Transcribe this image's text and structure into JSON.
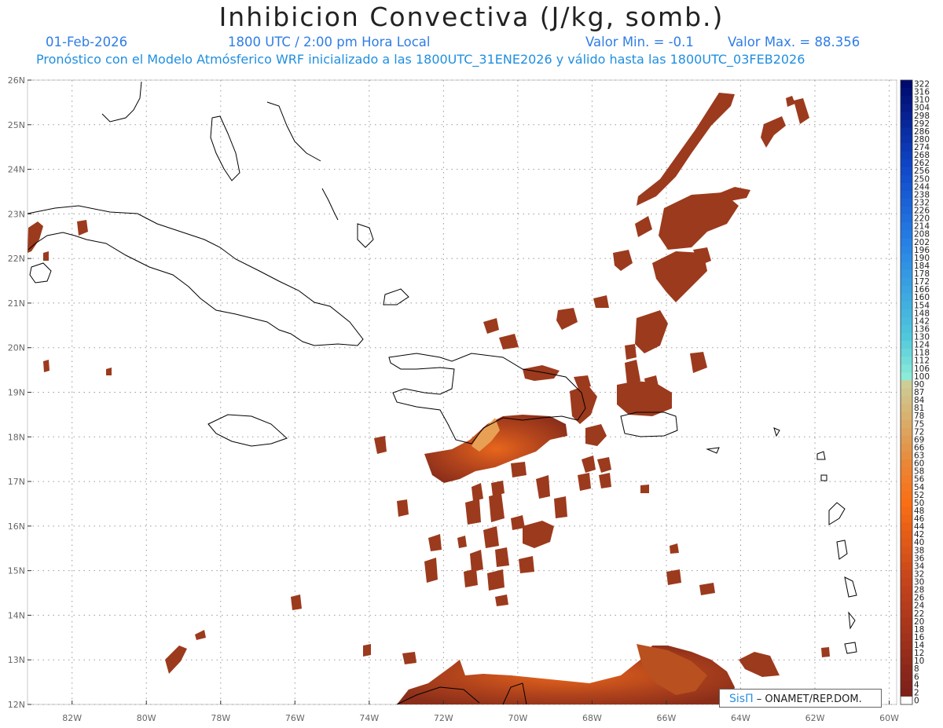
{
  "header": {
    "title": "Inhibicion Convectiva (J/kg, somb.)",
    "date": "01-Feb-2026",
    "time": "1800 UTC / 2:00 pm Hora Local",
    "valmin": "Valor Min. = -0.1",
    "valmax": "Valor Max. = 88.356",
    "forecast": "Pronóstico con el Modelo Atmósferico WRF inicializado a las 1800UTC_31ENE2026 y válido hasta las  1800UTC_03FEB2026"
  },
  "map": {
    "lat_labels": [
      "26N",
      "25N",
      "24N",
      "23N",
      "22N",
      "21N",
      "20N",
      "19N",
      "18N",
      "17N",
      "16N",
      "15N",
      "14N",
      "13N",
      "12N"
    ],
    "lon_labels": [
      "82W",
      "80W",
      "78W",
      "76W",
      "74W",
      "72W",
      "70W",
      "68W",
      "66W",
      "64W",
      "62W",
      "60W"
    ],
    "lat_range": [
      12,
      26
    ],
    "lon_range": [
      -83.2,
      -59.8
    ],
    "grid": "dotted"
  },
  "colorbar": {
    "labels": [
      "322",
      "316",
      "310",
      "304",
      "298",
      "292",
      "286",
      "280",
      "274",
      "268",
      "262",
      "256",
      "250",
      "244",
      "238",
      "232",
      "226",
      "220",
      "214",
      "208",
      "202",
      "196",
      "190",
      "184",
      "178",
      "172",
      "166",
      "160",
      "154",
      "148",
      "142",
      "136",
      "130",
      "124",
      "118",
      "112",
      "106",
      "100",
      "90",
      "87",
      "84",
      "81",
      "78",
      "75",
      "72",
      "69",
      "66",
      "63",
      "60",
      "58",
      "56",
      "54",
      "52",
      "50",
      "48",
      "46",
      "44",
      "42",
      "40",
      "38",
      "36",
      "34",
      "32",
      "30",
      "28",
      "26",
      "24",
      "22",
      "20",
      "18",
      "16",
      "14",
      "12",
      "10",
      "8",
      "6",
      "4",
      "2",
      "0"
    ]
  },
  "credit": {
    "brand": "SisΠ",
    "text": "– ONAMET/REP.DOM."
  }
}
